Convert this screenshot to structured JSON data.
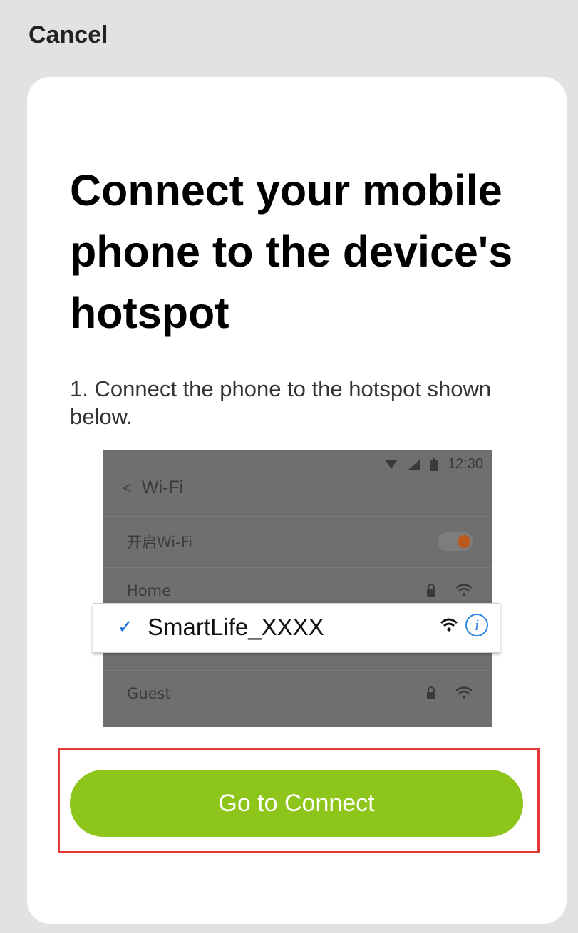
{
  "header": {
    "cancel_label": "Cancel"
  },
  "card": {
    "title": "Connect your mobile phone to the device's hotspot",
    "instruction": "1. Connect the phone to the hotspot shown below.",
    "illustration": {
      "status_time": "12:30",
      "nav_back_glyph": "<",
      "nav_title": "Wi-Fi",
      "wifi_toggle_label": "开启Wi-Fi",
      "wifi_toggle_on": true,
      "networks": [
        {
          "name": "Home",
          "locked": true
        },
        {
          "name": "SmartLife_XXXX",
          "selected": true
        },
        {
          "name": "Guest",
          "locked": true
        }
      ],
      "selected_check_glyph": "✓",
      "info_glyph": "i"
    },
    "connect_button_label": "Go to Connect"
  },
  "colors": {
    "background": "#e2e2e2",
    "card": "#ffffff",
    "accent_green": "#8ec51b",
    "highlight_red": "#e53935",
    "selected_blue": "#1e6fd9",
    "illustration_dim": "#6f6f6f"
  }
}
